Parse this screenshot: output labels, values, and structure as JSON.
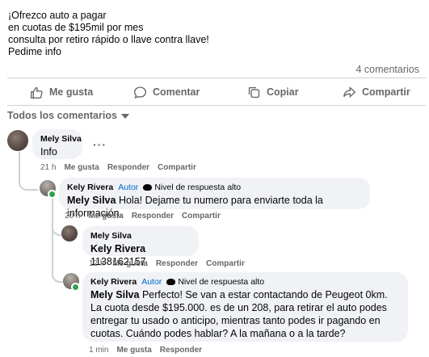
{
  "post": {
    "lines": [
      "¡Ofrezco auto a pagar",
      "en cuotas de $195mil por mes",
      "consulta por retiro rápido o llave contra llave!",
      "Pedime info"
    ],
    "comment_count": "4 comentarios"
  },
  "actions": {
    "like": "Me gusta",
    "comment": "Comentar",
    "copy": "Copiar",
    "share": "Compartir"
  },
  "sort_label": "Todos los comentarios",
  "comments": [
    {
      "author": "Mely Silva",
      "text": "Info",
      "time": "21 h",
      "like": "Me gusta",
      "reply": "Responder",
      "share": "Compartir"
    },
    {
      "author": "Kely Rivera",
      "role": "Autor",
      "badge": "Nivel de respuesta alto",
      "mention": "Mely Silva",
      "text": "Hola! Dejame tu numero para enviarte toda la información.",
      "time": "20 h",
      "like": "Me gusta",
      "reply": "Responder",
      "share": "Compartir"
    },
    {
      "author": "Mely Silva",
      "mention": "Kely Rivera",
      "text": "1138162157",
      "time": "12 h",
      "like": "Me gusta",
      "reply": "Responder",
      "share": "Compartir"
    },
    {
      "author": "Kely Rivera",
      "role": "Autor",
      "badge": "Nivel de respuesta alto",
      "mention": "Mely Silva",
      "text": "Perfecto! Se van a estar contactando de Peugeot 0km. La cuota desde $195.000. es de un 208, para retirar el auto podes entregar tu usado o anticipo, mientras tanto podes ir pagando en cuotas. Cuándo podes hablar? A la mañana o a la tarde?",
      "time": "1 min",
      "like": "Me gusta",
      "reply": "Responder"
    }
  ],
  "colors": {
    "accent": "#0064d1",
    "muted": "#65676b",
    "bubble": "#f0f2f5",
    "online": "#31a24c"
  }
}
